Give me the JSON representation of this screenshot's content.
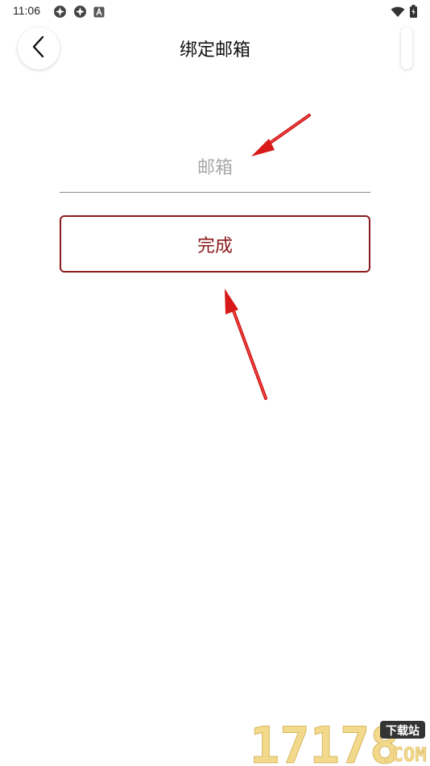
{
  "status_bar": {
    "time": "11:06",
    "icons": [
      "app-icon",
      "app-icon",
      "notification-icon",
      "wifi-icon",
      "battery-icon"
    ]
  },
  "header": {
    "title": "绑定邮箱",
    "back_icon": "chevron-left-icon"
  },
  "form": {
    "email_placeholder": "邮箱",
    "email_value": "",
    "done_label": "完成"
  },
  "colors": {
    "accent": "#8b1a1a",
    "annotation_arrow": "#e01e1e",
    "field_underline": "#8a8a8a",
    "placeholder": "#a8a8a8"
  },
  "watermark": {
    "text": "17178",
    "badge": "下载站",
    "suffix": ".COM"
  }
}
